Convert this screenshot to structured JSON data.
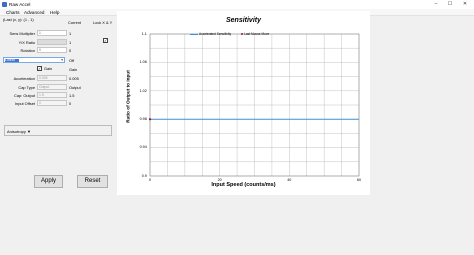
{
  "window": {
    "title": "Raw Accel",
    "controls": [
      "–",
      "☐",
      "✕"
    ]
  },
  "menu": {
    "items": [
      "Charts",
      "Advanced",
      "Help"
    ]
  },
  "settings": {
    "col_current": "Current",
    "col_lock": "Lock X & Y",
    "last_xy_label": "(Last (x, y): (1 , 1)",
    "sens_label": "Sens Multiplier",
    "sens_value": "1",
    "sens_current": "1",
    "ratio_label": "Y/X Ratio",
    "ratio_current": "1",
    "rotation_label": "Rotation",
    "rotation_value": "0",
    "rotation_current": "0",
    "mode_value": "Linear",
    "mode_current": "Off",
    "gain_label": "Gain",
    "gain_current": "Gain",
    "accel_label": "Acceleration",
    "accel_value": "0.005",
    "accel_current": "0.005",
    "captype_label": "Cap Type",
    "captype_value": "Output",
    "captype_current": "Output",
    "capoutput_label": "Cap: Output",
    "capoutput_value": "1.5",
    "capoutput_current": "1.5",
    "inputoffset_label": "Input Offset",
    "inputoffset_value": "0",
    "inputoffset_current": "0",
    "lock_checked": true,
    "gain_checked": true
  },
  "anisotropy": {
    "label": "Anisotropy ▼"
  },
  "buttons": {
    "apply": "Apply",
    "reset": "Reset"
  },
  "chart_data": {
    "type": "line",
    "title": "Sensitivity",
    "xlabel": "Input Speed (counts/ms)",
    "ylabel": "Ratio of Output to Input",
    "xlim": [
      0,
      60
    ],
    "ylim": [
      0.9,
      1.1
    ],
    "x_ticks": [
      0,
      20,
      40,
      60
    ],
    "y_ticks": [
      "0.9",
      "0.94",
      "0.98",
      "1.02",
      "1.06",
      "1.1"
    ],
    "grid": true,
    "legend": "top-center",
    "series": [
      {
        "name": "Accelerated Sensitivity",
        "color": "#3f8fd8",
        "x": [
          0,
          60
        ],
        "y": [
          0.98,
          0.98
        ]
      },
      {
        "name": "Last Mouse Move",
        "color": "#8b1a1a",
        "x": [
          0
        ],
        "y": [
          0.98
        ]
      }
    ]
  }
}
